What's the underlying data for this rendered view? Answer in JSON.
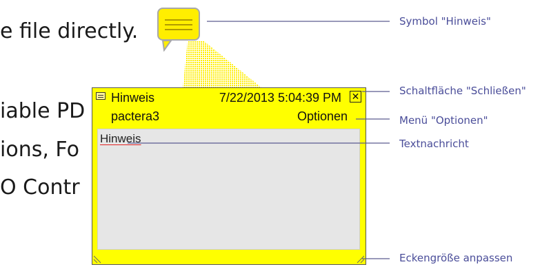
{
  "background_text": [
    "e file directly.",
    "iable PD",
    "ions, Fo",
    "O Contr"
  ],
  "annotation": {
    "title": "Hinweis",
    "timestamp": "7/22/2013 5:04:39 PM",
    "close_glyph": "✕",
    "author": "pactera3",
    "options_label": "Optionen",
    "options_arrow": "-",
    "body_text": "Hinweis",
    "note_color": "#ffff00"
  },
  "callouts": [
    "Symbol \"Hinweis\"",
    "Schaltfläche \"Schließen\"",
    "Menü \"Optionen\"",
    "Textnachricht",
    "Eckengröße anpassen"
  ],
  "colors": {
    "callout_text": "#4a4d99",
    "callout_line": "#5a5a8f",
    "underline": "#e02020"
  },
  "icons": {
    "note_symbol": "comment-note-icon",
    "close": "close-icon",
    "resize": "resize-corner-icon"
  }
}
